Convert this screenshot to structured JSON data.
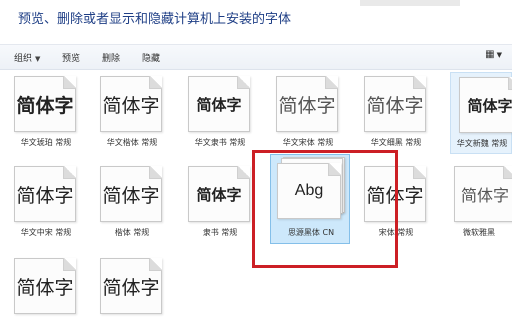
{
  "header": {
    "title": "预览、删除或者显示和隐藏计算机上安装的字体"
  },
  "toolbar": {
    "organize": "组织",
    "preview": "预览",
    "delete": "删除",
    "hide": "隐藏",
    "view_icon": "view-options-icon"
  },
  "fonts": [
    {
      "sample": "简体字",
      "caption": "华文琥珀 常规"
    },
    {
      "sample": "简体字",
      "caption": "华文楷体 常规"
    },
    {
      "sample": "简体字",
      "caption": "华文隶书 常规"
    },
    {
      "sample": "简体字",
      "caption": "华文宋体 常规"
    },
    {
      "sample": "简体字",
      "caption": "华文细黑 常规"
    },
    {
      "sample": "简体字",
      "caption": "华文新魏 常规"
    },
    {
      "sample": "简体字",
      "caption": "华文中宋 常规"
    },
    {
      "sample": "简体字",
      "caption": "楷体 常规"
    },
    {
      "sample": "简体字",
      "caption": "隶书 常规"
    },
    {
      "sample": "Abg",
      "caption": "思源黑体 CN"
    },
    {
      "sample": "简体字",
      "caption": "宋体 常规"
    },
    {
      "sample": "简体字",
      "caption": "微软雅黑"
    },
    {
      "sample": "简体字",
      "caption": ""
    },
    {
      "sample": "简体字",
      "caption": ""
    }
  ],
  "colors": {
    "title": "#1f3f86",
    "selection": "#cde8fb",
    "highlight_box": "#cc1f25"
  }
}
